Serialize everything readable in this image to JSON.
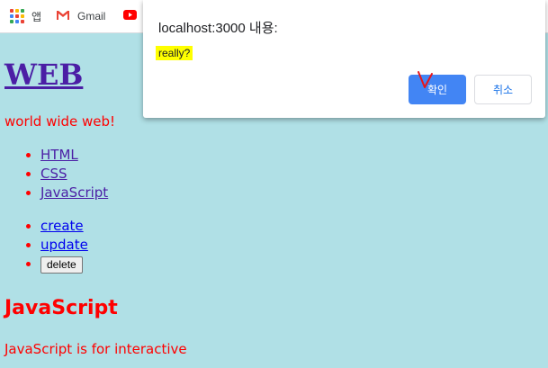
{
  "bookmarks": {
    "apps_label": "앱",
    "gmail_label": "Gmail",
    "icons": [
      "apps-grid-icon",
      "gmail-icon",
      "youtube-icon"
    ]
  },
  "page": {
    "title": "WEB",
    "intro": "world wide web!",
    "nav_items": [
      "HTML",
      "CSS",
      "JavaScript"
    ],
    "actions": {
      "create": "create",
      "update": "update",
      "delete": "delete"
    },
    "section_title": "JavaScript",
    "section_body": "JavaScript is for interactive"
  },
  "dialog": {
    "title": "localhost:3000 내용:",
    "message": "really?",
    "ok_label": "확인",
    "cancel_label": "취소"
  },
  "colors": {
    "background": "#b0e0e6",
    "text_red": "#ff0000",
    "link_visited": "#4b1ea5",
    "link": "#0000ee",
    "highlight": "#ffff00",
    "primary_button": "#4285f4"
  }
}
